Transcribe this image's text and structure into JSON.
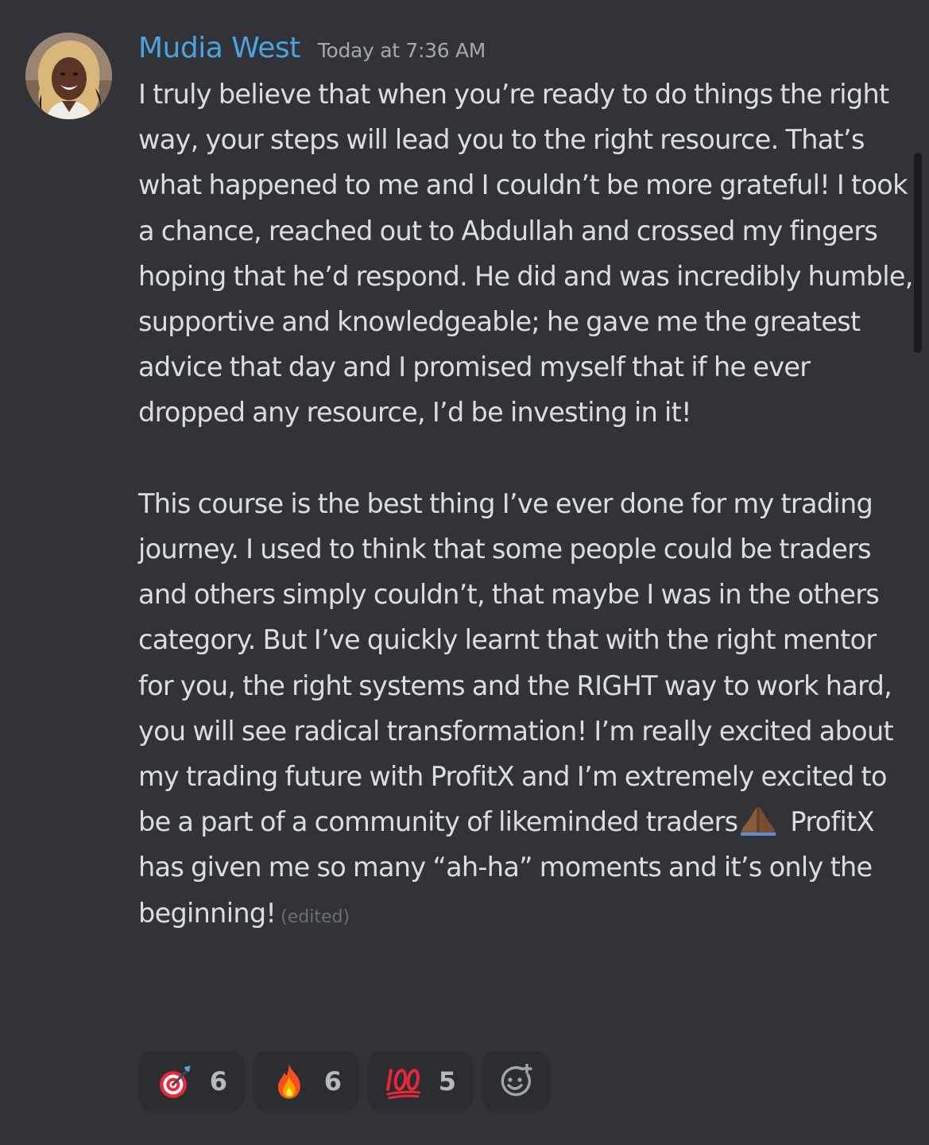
{
  "message": {
    "author": "Mudia West",
    "timestamp": "Today at 7:36 AM",
    "paragraph1": "I truly believe that when you’re ready to do things the right way, your steps will lead you to the right resource. That’s what happened to me and I couldn’t be more grateful! I took a chance, reached out to Abdullah and crossed my fingers hoping that he’d respond. He did and was incredibly humble, supportive and knowledgeable; he gave me the greatest advice that day and I promised myself that if he ever dropped any resource, I’d be investing in it!",
    "paragraph2_before_emoji": "This course is the best thing I’ve ever done for my trading journey. I used to think that some people could be traders and others simply couldn’t, that maybe I was in the others category. But I’ve quickly learnt that with the right mentor for you, the right systems and the RIGHT way to work hard, you will see radical transformation! I’m really excited about my trading future with ProfitX and I’m extremely excited to be a part of a community of likeminded traders",
    "inline_emoji": "folded-hands-emoji",
    "paragraph2_after_emoji": "ProfitX has given me so many “ah-ha” moments and it’s only the beginning!",
    "edited_label": "(edited)"
  },
  "reactions": [
    {
      "emoji": "direct-hit-emoji",
      "count": "6"
    },
    {
      "emoji": "fire-emoji",
      "count": "6"
    },
    {
      "emoji": "hundred-points-emoji",
      "count": "5"
    }
  ],
  "add_reaction": {
    "icon": "add-reaction-icon"
  },
  "colors": {
    "background": "#313338",
    "author": "#4ca3e0",
    "text": "#dbdee1",
    "timestamp": "#a5a8ad",
    "reaction_bg": "#2b2d31"
  }
}
